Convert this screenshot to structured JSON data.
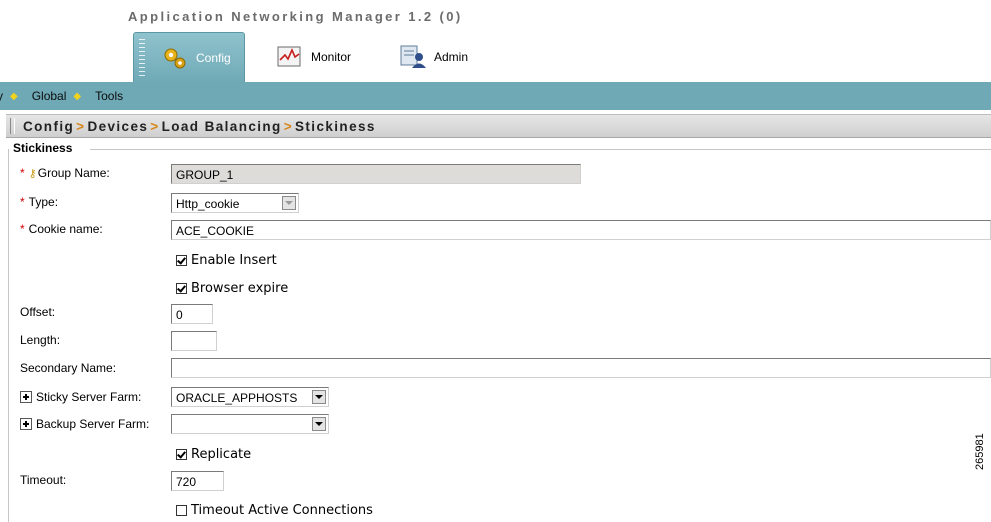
{
  "app": {
    "title": "Application Networking Manager 1.2 (0)"
  },
  "tabs": [
    {
      "label": "Config",
      "icon": "gears-icon",
      "active": true
    },
    {
      "label": "Monitor",
      "icon": "chart-icon",
      "active": false
    },
    {
      "label": "Admin",
      "icon": "admin-icon",
      "active": false
    }
  ],
  "menu": [
    {
      "label": "y",
      "icon": "arrow-icon"
    },
    {
      "label": "Global",
      "icon": "arrow-icon"
    },
    {
      "label": "Tools"
    }
  ],
  "breadcrumb": [
    "Config",
    "Devices",
    "Load Balancing",
    "Stickiness"
  ],
  "section": {
    "title": "Stickiness"
  },
  "form": {
    "group_name": {
      "label": "Group Name:",
      "required": true,
      "value": "GROUP_1"
    },
    "type": {
      "label": "Type:",
      "required": true,
      "value": "Http_cookie"
    },
    "cookie_name": {
      "label": "Cookie name:",
      "required": true,
      "value": "ACE_COOKIE"
    },
    "enable_insert": {
      "label": "Enable Insert",
      "checked": true
    },
    "browser_expire": {
      "label": "Browser expire",
      "checked": true
    },
    "offset": {
      "label": "Offset:",
      "value": "0"
    },
    "length": {
      "label": "Length:",
      "value": ""
    },
    "secondary_name": {
      "label": "Secondary Name:",
      "value": ""
    },
    "sticky_server_farm": {
      "label": "Sticky Server Farm:",
      "value": "ORACLE_APPHOSTS"
    },
    "backup_server_farm": {
      "label": "Backup Server Farm:",
      "value": ""
    },
    "replicate": {
      "label": "Replicate",
      "checked": true
    },
    "timeout": {
      "label": "Timeout:",
      "value": "720"
    },
    "timeout_active_connections": {
      "label": "Timeout Active Connections",
      "checked": false
    }
  },
  "figure_id": "265981",
  "colors": {
    "menubar": "#6fa9b6",
    "required": "#d00000",
    "breadcrumb_separator": "#d8861a"
  }
}
